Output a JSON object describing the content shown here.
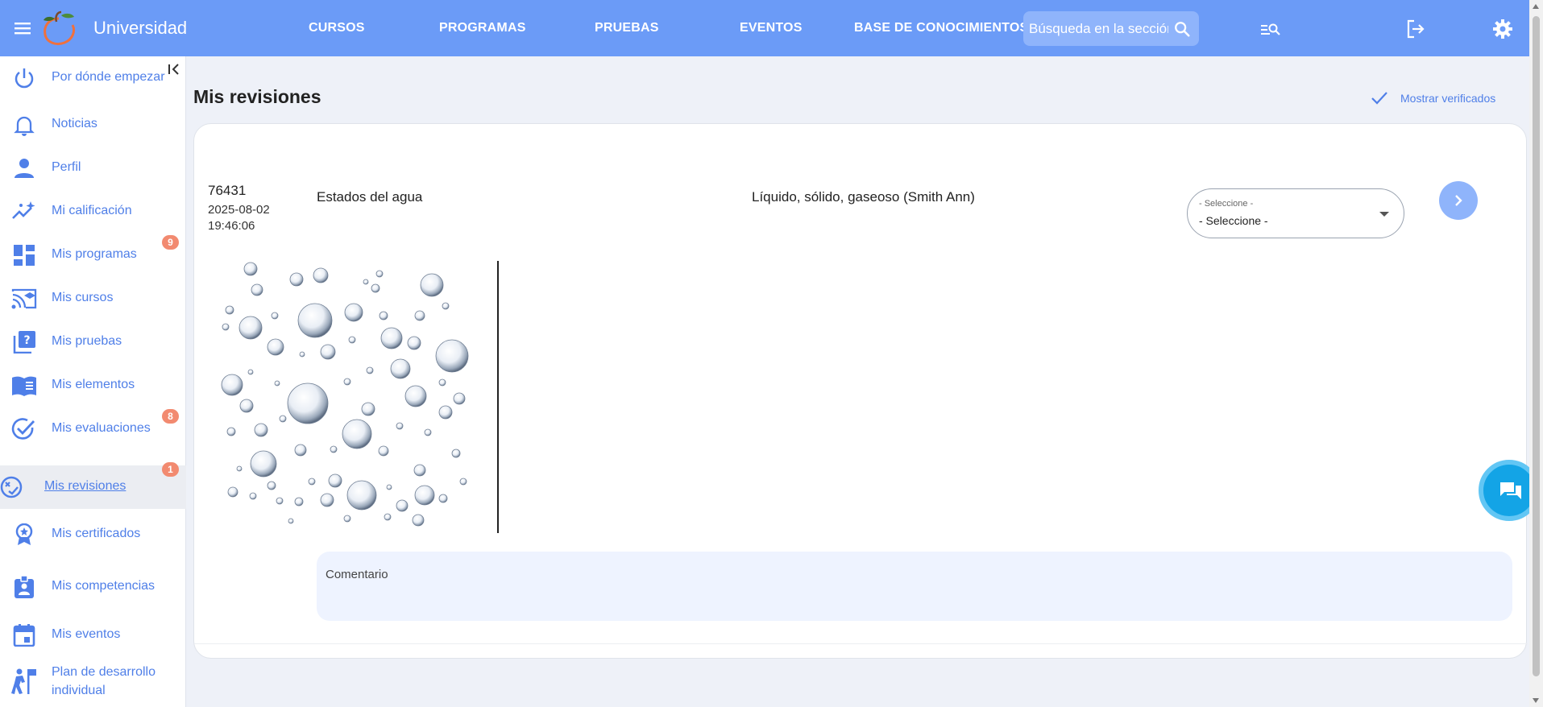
{
  "header": {
    "brand": "Universidad",
    "nav": [
      {
        "label": "CURSOS"
      },
      {
        "label": "PROGRAMAS"
      },
      {
        "label": "PRUEBAS"
      },
      {
        "label": "EVENTOS"
      },
      {
        "label": "BASE DE CONOCIMIENTOS"
      }
    ],
    "search_placeholder": "Búsqueda en la sección",
    "icons": [
      "menu-icon",
      "search-icon",
      "advanced-search-icon",
      "logout-icon",
      "settings-icon"
    ]
  },
  "sidebar": {
    "items": [
      {
        "label": "Por dónde empezar",
        "icon": "power-icon"
      },
      {
        "label": "Noticias",
        "icon": "bell-icon"
      },
      {
        "label": "Perfil",
        "icon": "person-icon"
      },
      {
        "label": "Mi calificación",
        "icon": "trend-sparkle-icon"
      },
      {
        "label": "Mis programas",
        "icon": "dashboard-icon",
        "badge": "9"
      },
      {
        "label": "Mis cursos",
        "icon": "cast-school-icon"
      },
      {
        "label": "Mis pruebas",
        "icon": "quiz-icon"
      },
      {
        "label": "Mis elementos",
        "icon": "book-icon"
      },
      {
        "label": "Mis evaluaciones",
        "icon": "check-circle-icon",
        "badge": "8"
      },
      {
        "label": "Mis revisiones",
        "icon": "review-icon",
        "badge": "1",
        "active": true
      },
      {
        "label": "Mis certificados",
        "icon": "award-icon"
      },
      {
        "label": "Mis competencias",
        "icon": "badge-icon"
      },
      {
        "label": "Mis eventos",
        "icon": "calendar-icon"
      },
      {
        "label": "Plan de desarrollo individual",
        "icon": "climb-icon"
      }
    ]
  },
  "main": {
    "title": "Mis revisiones",
    "show_verified": "Mostrar verificados",
    "review": {
      "id": "76431",
      "date": "2025-08-02",
      "time": "19:46:06",
      "course": "Estados del agua",
      "answer": "Líquido, sólido, gaseoso (Smith Ann)",
      "select_caption": "- Seleccione -",
      "select_value": "- Seleccione -",
      "comment_label": "Comentario"
    }
  },
  "colors": {
    "primary": "#6b9bf7",
    "accent_text": "#4f7fe8",
    "badge": "#f28a70",
    "chat": "#13a4e6"
  }
}
